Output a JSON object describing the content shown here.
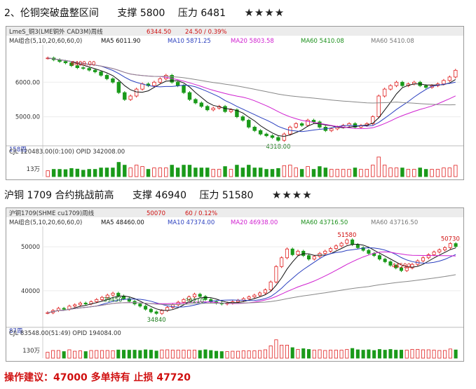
{
  "section1": {
    "title": "2、伦铜突破盘整区间",
    "support": "支撑 5800",
    "pressure": "压力 6481",
    "stars": "★★★★"
  },
  "section2": {
    "title": "沪铜 1709 合约挑战前高",
    "support": "支撑 46940",
    "pressure": "压力 51580",
    "stars": "★★★★"
  },
  "advice": "操作建议：47000 多单持有   止损 47720",
  "chart_data": [
    {
      "type": "candlestick",
      "symbol_bar": "LmeS_铜3(LME铜外 CAD3M)周线",
      "price": "6344.50",
      "change": "24.50 / 0.39%",
      "ma_label": "MA组合(5,10,20,60,60,0)",
      "ma_values": [
        {
          "label": "MA5 6011.90",
          "color": "#111111"
        },
        {
          "label": "MA10 5871.25",
          "color": "#2a3fbf"
        },
        {
          "label": "MA20 5803.58",
          "color": "#d020d0"
        },
        {
          "label": "MA60 5410.08",
          "color": "#1a8f1a"
        },
        {
          "label": "MA60 5410.08",
          "color": "#777777"
        }
      ],
      "y_ticks": [
        "6000.00",
        "5000.00"
      ],
      "ylim": [
        4200,
        7000
      ],
      "annotations": [
        {
          "text": "6400.00",
          "value": 6400
        },
        {
          "text": "4318.00",
          "value": 4318
        }
      ],
      "period_label": "158周",
      "volume_info": "CJL  120483.00(0:100)     OPID  342008.00",
      "volume_tick": "13万",
      "closes": [
        6700,
        6650,
        6600,
        6560,
        6480,
        6420,
        6400,
        6350,
        6300,
        6200,
        6100,
        6000,
        5700,
        5500,
        5600,
        5800,
        5950,
        5900,
        6000,
        6100,
        6200,
        6000,
        5900,
        5700,
        5500,
        5400,
        5300,
        5200,
        5250,
        5300,
        5150,
        5200,
        5000,
        4900,
        4700,
        4600,
        4500,
        4450,
        4400,
        4318,
        4500,
        4700,
        4800,
        4750,
        4900,
        4850,
        4700,
        4600,
        4650,
        4700,
        4750,
        4800,
        4700,
        4750,
        4800,
        5000,
        5600,
        5800,
        5900,
        6000,
        5900,
        5950,
        6000,
        5900,
        5850,
        5900,
        5950,
        6050,
        6150,
        6344
      ]
    },
    {
      "type": "candlestick",
      "symbol_bar": "沪铜1709(SHME cu1709)周线",
      "price": "50070",
      "change": "60 / 0.12%",
      "ma_label": "MA组合(5,10,20,60,60,0)",
      "ma_values": [
        {
          "label": "MA5 48460.00",
          "color": "#111111"
        },
        {
          "label": "MA10 47374.00",
          "color": "#2a3fbf"
        },
        {
          "label": "MA20 46938.00",
          "color": "#d020d0"
        },
        {
          "label": "MA60 43716.50",
          "color": "#1a8f1a"
        },
        {
          "label": "MA60 43716.50",
          "color": "#777777"
        }
      ],
      "y_ticks": [
        "50000",
        "40000"
      ],
      "ylim": [
        32000,
        54000
      ],
      "annotations": [
        {
          "text": "51580",
          "value": 51580
        },
        {
          "text": "50730",
          "value": 50730
        },
        {
          "text": "39450",
          "value": 39450
        },
        {
          "text": "39210",
          "value": 39210
        },
        {
          "text": "44590",
          "value": 44590
        },
        {
          "text": "34840",
          "value": 34840
        }
      ],
      "period_label": "87周",
      "volume_info": "CJL  83548.00(51:49)     OPID  194084.00",
      "volume_tick": "130万",
      "closes": [
        35000,
        35500,
        36000,
        35800,
        36500,
        36800,
        37200,
        37000,
        37500,
        38000,
        38500,
        39000,
        39450,
        38800,
        38200,
        37600,
        37000,
        36500,
        35800,
        35200,
        34840,
        35500,
        36200,
        36800,
        37400,
        38000,
        38600,
        39210,
        38700,
        38000,
        37500,
        37200,
        37000,
        37200,
        37500,
        37800,
        38200,
        38600,
        39000,
        39500,
        40200,
        42000,
        45500,
        47500,
        49500,
        48200,
        49000,
        48000,
        47200,
        47800,
        48500,
        49000,
        49600,
        50200,
        50800,
        51580,
        50500,
        49800,
        49200,
        48500,
        48000,
        47200,
        46600,
        45800,
        45200,
        44590,
        45200,
        46000,
        46800,
        47500,
        48200,
        48800,
        49300,
        49800,
        50730,
        50070
      ]
    }
  ]
}
